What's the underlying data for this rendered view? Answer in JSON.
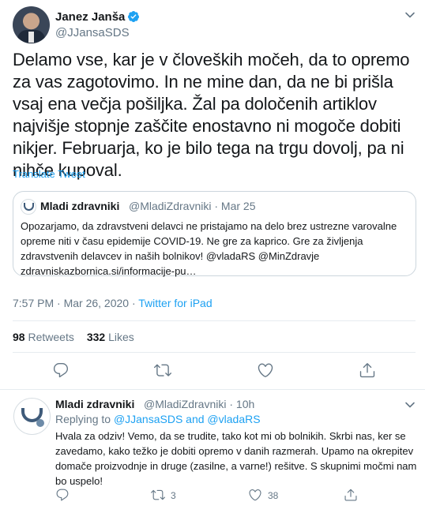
{
  "tweet": {
    "author_name": "Janez Janša",
    "author_handle": "@JJansaSDS",
    "text": "Delamo vse, kar je v človeških močeh, da to opremo za vas zagotovimo. In ne mine dan, da ne bi prišla vsaj ena večja pošiljka. Žal pa določenih artiklov najvišje stopnje zaščite enostavno ni mogoče dobiti nikjer. Februarja, ko je bilo tega na trgu dovolj, pa ni nihče kupoval.",
    "translate_label": "Translate Tweet",
    "timestamp": "7:57 PM · Mar 26, 2020 · ",
    "source": "Twitter for iPad",
    "retweets_count": "98",
    "retweets_label": "Retweets",
    "likes_count": "332",
    "likes_label": "Likes",
    "quoted": {
      "author_name": "Mladi zdravniki",
      "author_handle": "@MladiZdravniki",
      "date": "· Mar 25",
      "text": "Opozarjamo, da zdravstveni delavci ne pristajamo na delo brez ustrezne varovalne opreme niti v času epidemije COVID-19. Ne gre za kaprico. Gre za življenja zdravstvenih delavcev in naših bolnikov! @vladaRS @MinZdravje zdravniskazbornica.si/informacije-pu…"
    }
  },
  "reply": {
    "author_name": "Mladi zdravniki",
    "author_handle": "@MladiZdravniki",
    "time": "· 10h",
    "replying_prefix": "Replying to ",
    "replying_targets": "@JJansaSDS and @vladaRS",
    "text": "Hvala za odziv! Vemo, da se trudite, tako kot mi ob bolnikih. Skrbi nas, ker se zavedamo, kako težko je dobiti opremo v danih razmerah. Upamo na okrepitev domače proizvodnje in druge (zasilne, a varne!) rešitve. S skupnimi močmi nam bo uspelo!",
    "retweet_count": "3",
    "like_count": "38"
  },
  "colors": {
    "accent": "#1da1f2",
    "secondary_text": "#657786",
    "primary_text": "#14171a",
    "divider": "#e6ecf0"
  },
  "icons": [
    "verified-badge-icon",
    "chevron-down-icon",
    "reply-icon",
    "retweet-icon",
    "like-icon",
    "share-icon"
  ]
}
